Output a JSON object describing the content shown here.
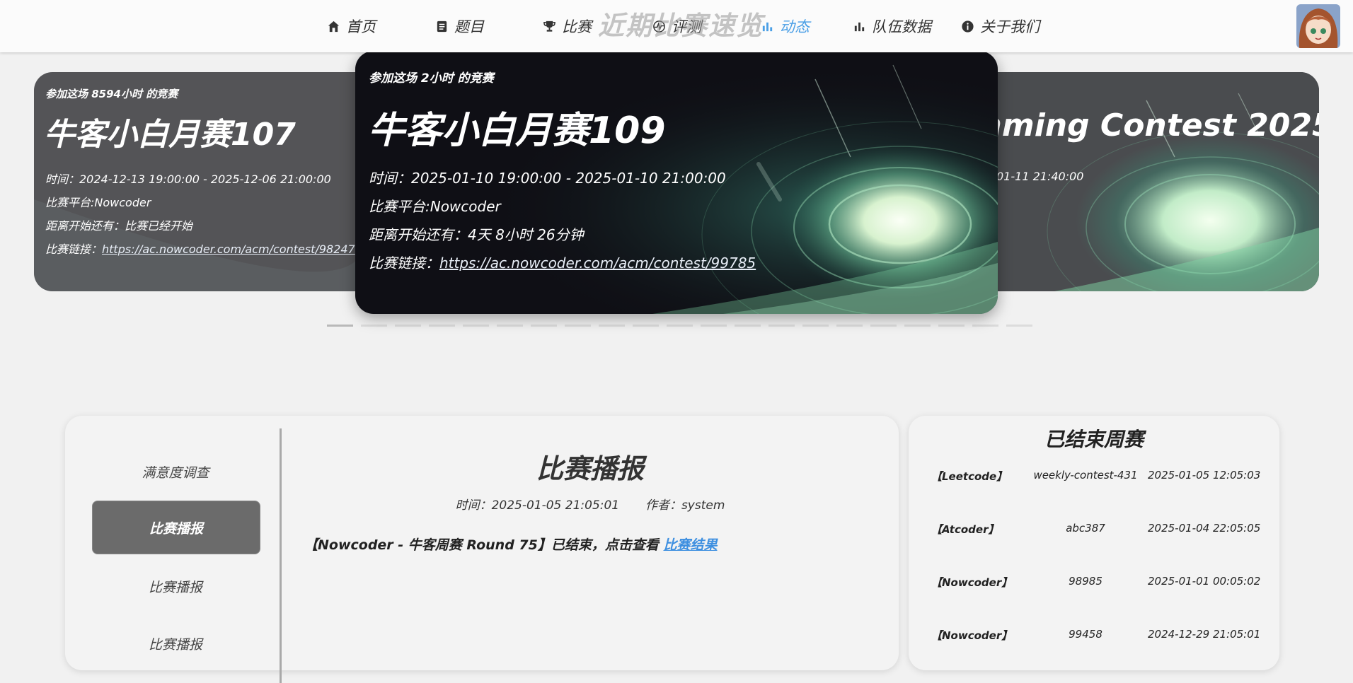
{
  "nav": {
    "items": [
      {
        "label": "首页",
        "icon": "home-icon"
      },
      {
        "label": "题目",
        "icon": "document-icon"
      },
      {
        "label": "比赛",
        "icon": "trophy-icon"
      },
      {
        "label": "评测",
        "icon": "pulse-icon"
      },
      {
        "label": "动态",
        "icon": "bar-chart-icon",
        "active": true
      },
      {
        "label": "队伍数据",
        "icon": "bar-chart-icon"
      },
      {
        "label": "关于我们",
        "icon": "info-icon"
      }
    ],
    "overlay_title": "近期比赛速览",
    "accent_color": "#4a9fe6"
  },
  "carousel": {
    "left_card": {
      "header": "参加这场 8594小时 的竞赛",
      "title": "牛客小白月赛107",
      "time": "时间：2024-12-13 19:00:00 - 2025-12-06 21:00:00",
      "platform": "比赛平台:Nowcoder",
      "countdown": "距离开始还有：比赛已经开始",
      "link_label": "比赛链接：",
      "link": "https://ac.nowcoder.com/acm/contest/98247"
    },
    "center_card": {
      "header": "参加这场 2小时 的竞赛",
      "title": "牛客小白月赛109",
      "time": "时间：2025-01-10 19:00:00 - 2025-01-10 21:00:00",
      "platform": "比赛平台:Nowcoder",
      "countdown": "距离开始还有：4天 8小时 26分钟",
      "link_label": "比赛链接：",
      "link": "https://ac.nowcoder.com/acm/contest/99785"
    },
    "right_card": {
      "title_fragment": "mming Contest 2025(...",
      "time_fragment": "01-11 21:40:00"
    },
    "dot_count": 21,
    "active_dot": 0
  },
  "side_menu": {
    "items": [
      {
        "label": "满意度调查"
      },
      {
        "label": "比赛播报",
        "active": true
      },
      {
        "label": "比赛播报"
      },
      {
        "label": "比赛播报"
      }
    ]
  },
  "article": {
    "title": "比赛播报",
    "time_label": "时间：2025-01-05 21:05:01",
    "author_label": "作者：system",
    "body": "【Nowcoder - 牛客周赛 Round 75】已结束，点击查看 ",
    "body_link": "比赛结果"
  },
  "ended": {
    "title": "已结束周赛",
    "rows": [
      {
        "platform": "【Leetcode】",
        "name": "weekly-contest-431",
        "time": "2025-01-05 12:05:03"
      },
      {
        "platform": "【Atcoder】",
        "name": "abc387",
        "time": "2025-01-04 22:05:05"
      },
      {
        "platform": "【Nowcoder】",
        "name": "98985",
        "time": "2025-01-01 00:05:02"
      },
      {
        "platform": "【Nowcoder】",
        "name": "99458",
        "time": "2024-12-29 21:05:01"
      }
    ]
  }
}
